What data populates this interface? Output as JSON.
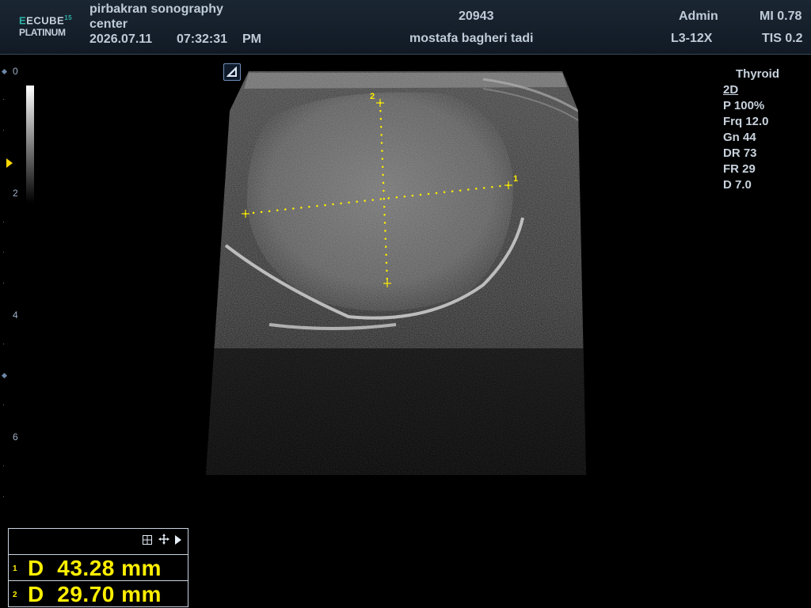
{
  "header": {
    "logo_line1": "ECUBE",
    "logo_sup": "15",
    "logo_line2": "PLATINUM",
    "facility_line1": "pirbakran sonography",
    "facility_line2": "center",
    "date": "2026.07.11",
    "time": "07:32:31",
    "ampm": "PM",
    "patient_id": "20943",
    "patient_name": "mostafa bagheri tadi",
    "operator": "Admin",
    "probe": "L3-12X",
    "mi": "MI 0.78",
    "tis": "TIS 0.2"
  },
  "depth_ruler": {
    "labels": [
      "0",
      "2",
      "4",
      "6"
    ]
  },
  "probe_orientation_icon": "probe-orientation-icon",
  "params": {
    "preset": "Thyroid",
    "mode": "2D",
    "lines": [
      "P 100%",
      "Frq 12.0",
      "Gn 44",
      "DR 73",
      "FR 29",
      "D 7.0"
    ]
  },
  "calipers": {
    "1_label": "1",
    "2_label": "2"
  },
  "measurements": {
    "toolbar_icons": [
      "grid-icon",
      "move-icon",
      "play-arrow-icon"
    ],
    "rows": [
      {
        "index": "1",
        "text": "D  43.28 mm"
      },
      {
        "index": "2",
        "text": "D  29.70 mm"
      }
    ]
  },
  "colors": {
    "caliper": "#ffef00",
    "header_bg": "#16202b",
    "accent": "#2fb3a8"
  }
}
